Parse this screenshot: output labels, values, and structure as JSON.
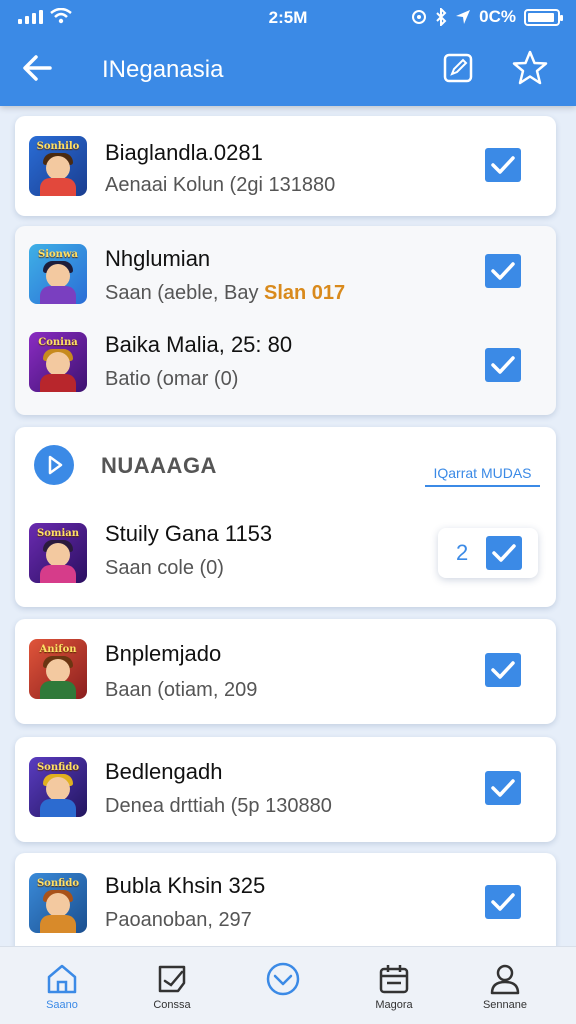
{
  "status_bar": {
    "time": "2:5M",
    "battery": "0C%"
  },
  "header": {
    "title": "INeganasia",
    "back_icon": "arrow-left-icon",
    "edit_icon": "edit-icon",
    "star_icon": "star-icon"
  },
  "colors": {
    "accent": "#3b8ae6",
    "highlight": "#d98a1c",
    "background": "#e6eef9"
  },
  "items": [
    {
      "thumb_label": "Sonhilo",
      "title": "Biaglandla.0281",
      "subtitle": "Aenaai Kolun (2gi 131880",
      "checked": true
    },
    {
      "thumb_label": "Sionwa",
      "title": "Nhglumian",
      "subtitle": "Saan (aeble, Bay",
      "subtitle_highlight": "Slan 017",
      "checked": true
    },
    {
      "thumb_label": "Conina",
      "title": "Baika Malia, 25: 80",
      "subtitle": "Batio (omar (0)",
      "checked": true
    },
    {
      "thumb_label": "Somian",
      "title": "Stuily Gana 1153",
      "subtitle": "Saan cole (0)",
      "checked": true,
      "count": "2"
    },
    {
      "thumb_label": "Anifon",
      "title": "Bnplemjado",
      "subtitle": "Baan (otiam, 209",
      "checked": true
    },
    {
      "thumb_label": "Sonfido",
      "title": "Bedlengadh",
      "subtitle": "Denea drttiah (5p 130880",
      "checked": true
    },
    {
      "thumb_label": "Sonfido",
      "title": "Bubla Khsin 325",
      "subtitle": "Paoanoban, 297",
      "checked": true
    }
  ],
  "section": {
    "title": "NUAAAGA",
    "link": "IQarrat MUDAS",
    "icon": "play-icon"
  },
  "bottom_nav": [
    {
      "label": "Saano",
      "icon": "home-icon",
      "active": true
    },
    {
      "label": "Conssa",
      "icon": "edit-card-icon",
      "active": false
    },
    {
      "label": "",
      "icon": "check-circle-icon",
      "active": false
    },
    {
      "label": "Magora",
      "icon": "calendar-icon",
      "active": false
    },
    {
      "label": "Sennane",
      "icon": "profile-icon",
      "active": false
    }
  ]
}
